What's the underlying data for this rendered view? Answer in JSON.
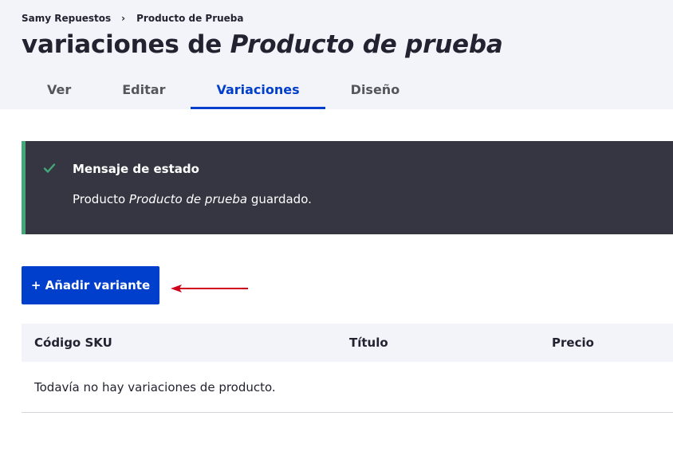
{
  "breadcrumb": {
    "items": [
      "Samy Repuestos",
      "Producto de Prueba"
    ],
    "separator": "›"
  },
  "title": {
    "prefix": "variaciones de ",
    "product": "Producto de prueba"
  },
  "tabs": [
    {
      "label": "Ver",
      "active": false
    },
    {
      "label": "Editar",
      "active": false
    },
    {
      "label": "Variaciones",
      "active": true
    },
    {
      "label": "Diseño",
      "active": false
    }
  ],
  "status": {
    "icon": "check-icon",
    "title": "Mensaje de estado",
    "message_prefix": "Producto ",
    "message_product": "Producto de prueba",
    "message_suffix": " guardado."
  },
  "add_button": {
    "label": "+ Añadir variante"
  },
  "annotation": {
    "icon": "red-arrow-icon",
    "color": "#d0021b"
  },
  "table": {
    "columns": [
      "Código SKU",
      "Título",
      "Precio"
    ],
    "empty_message": "Todavía no hay variaciones de producto."
  },
  "colors": {
    "accent": "#003ecc",
    "status_bg": "#353641",
    "status_border": "#42a877",
    "header_bg": "#f3f4f9"
  }
}
